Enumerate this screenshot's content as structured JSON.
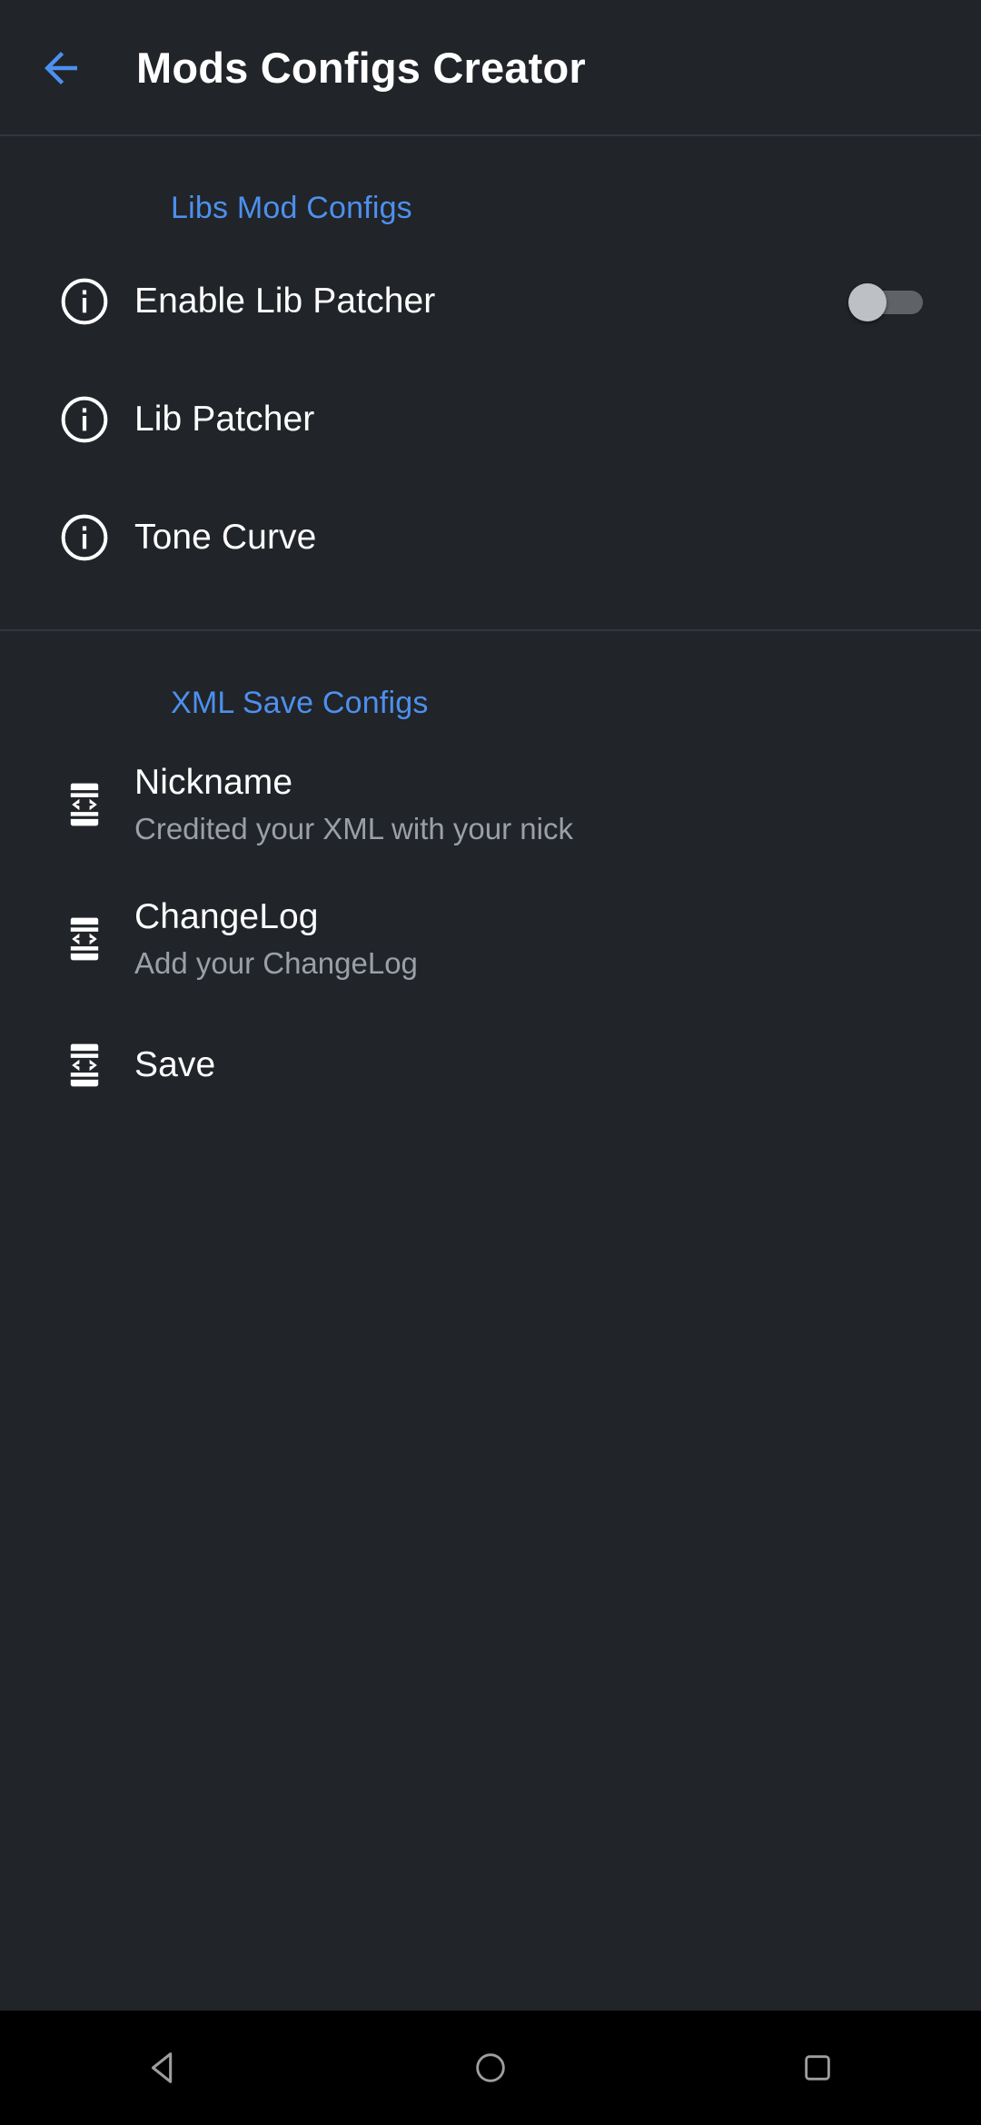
{
  "appbar": {
    "back_icon": "arrow-left-icon",
    "title": "Mods Configs Creator",
    "accent_color": "#4d90ee",
    "title_color": "#ffffff",
    "background_color": "#212429"
  },
  "sections": [
    {
      "header": "Libs Mod Configs",
      "rows": [
        {
          "icon": "info-icon",
          "title": "Enable Lib Patcher",
          "subtitle": "",
          "accessory": "toggle-switch",
          "toggle_state": "off"
        },
        {
          "icon": "info-icon",
          "title": "Lib Patcher",
          "subtitle": "",
          "accessory": "none"
        },
        {
          "icon": "info-icon",
          "title": "Tone Curve",
          "subtitle": "",
          "accessory": "none"
        }
      ]
    },
    {
      "header": "XML Save Configs",
      "rows": [
        {
          "icon": "xml-code-device-icon",
          "title": "Nickname",
          "subtitle": "Credited your XML with your nick",
          "accessory": "none"
        },
        {
          "icon": "xml-code-device-icon",
          "title": "ChangeLog",
          "subtitle": "Add your ChangeLog",
          "accessory": "none"
        },
        {
          "icon": "xml-code-device-icon",
          "title": "Save",
          "subtitle": "",
          "accessory": "none"
        }
      ]
    }
  ],
  "navbar": {
    "background_color": "#000000",
    "icon_color": "#9e9e9e",
    "buttons": [
      {
        "icon": "nav-back-triangle-icon",
        "label": "Back"
      },
      {
        "icon": "nav-home-circle-icon",
        "label": "Home"
      },
      {
        "icon": "nav-recents-square-icon",
        "label": "Recents"
      }
    ]
  },
  "colors": {
    "section_header": "#4d90ee",
    "title_text": "#ffffff",
    "subtitle_text": "#9aa0a6",
    "divider": "#33373d",
    "toggle_track_off": "#5f6368",
    "toggle_thumb_off": "#bdc1c6"
  }
}
